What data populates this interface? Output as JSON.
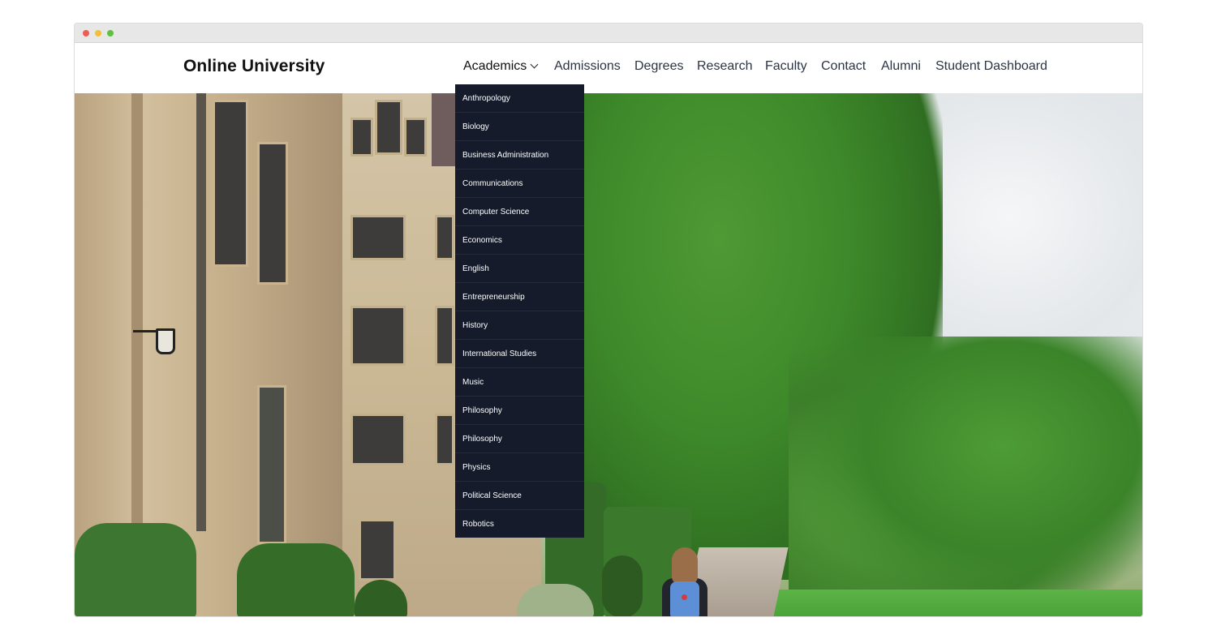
{
  "site": {
    "brand": "Online University"
  },
  "nav": {
    "items": [
      {
        "label": "Academics",
        "active": true,
        "has_dropdown": true
      },
      {
        "label": "Admissions"
      },
      {
        "label": "Degrees"
      },
      {
        "label": "Research"
      },
      {
        "label": "Faculty"
      },
      {
        "label": "Contact"
      },
      {
        "label": "Alumni"
      },
      {
        "label": "Student Dashboard"
      }
    ]
  },
  "dropdown": {
    "items": [
      "Anthropology",
      "Biology",
      "Business Administration",
      "Communications",
      "Computer Science",
      "Economics",
      "English",
      "Entrepreneurship",
      "History",
      "International Studies",
      "Music",
      "Philosophy",
      "Philosophy",
      "Physics",
      "Political Science",
      "Robotics"
    ]
  },
  "colors": {
    "dropdown_bg": "#151b2a",
    "nav_text": "#2b3445",
    "brand_text": "#111111"
  },
  "icons": {
    "window_controls": [
      "close-dot",
      "minimize-dot",
      "zoom-dot"
    ],
    "dropdown_indicator": "chevron-down-icon"
  }
}
